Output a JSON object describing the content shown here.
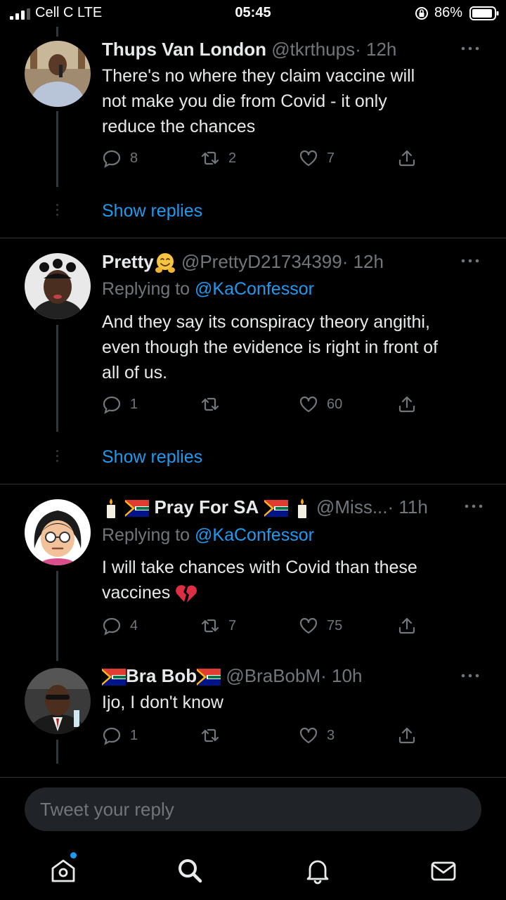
{
  "status_bar": {
    "carrier": "Cell C  LTE",
    "time": "05:45",
    "battery_percent": "86%",
    "icons": [
      "signal-icon",
      "orientation-lock-icon",
      "battery-icon"
    ]
  },
  "tweets": [
    {
      "display_name": "Thups Van London",
      "handle": "@tkrthups",
      "time": "· 12h",
      "text_lines": [
        "There's no where they claim vaccine will",
        "not make you die from Covid - it only",
        "reduce the chances"
      ],
      "replies": "8",
      "retweets": "2",
      "likes": "7",
      "show_replies": "Show replies"
    },
    {
      "display_name": "Pretty",
      "handle": "@PrettyD21734399",
      "time": "· 12h",
      "replying_prefix": "Replying to ",
      "replying_to": "@KaConfessor",
      "text_lines": [
        "And they say its conspiracy theory angithi,",
        "even though the evidence is right in front of",
        "all of us."
      ],
      "replies": "1",
      "retweets": "",
      "likes": "60",
      "show_replies": "Show replies"
    },
    {
      "display_name": "Pray For SA",
      "handle": "@Miss...",
      "time": "· 11h",
      "replying_prefix": "Replying to ",
      "replying_to": "@KaConfessor",
      "text_lines": [
        "I will take chances with Covid than these",
        "vaccines"
      ],
      "replies": "4",
      "retweets": "7",
      "likes": "75"
    },
    {
      "display_name": "Bra Bob",
      "handle": "@BraBobM",
      "time": "· 10h",
      "text_lines": [
        "Ijo, I don't know"
      ],
      "replies": "1",
      "retweets": "",
      "likes": "3"
    }
  ],
  "reply_box": {
    "placeholder": "Tweet your reply"
  },
  "tabbar": {
    "items": [
      "home-icon",
      "search-icon",
      "notifications-icon",
      "messages-icon"
    ]
  },
  "colors": {
    "background": "#000000",
    "accent": "#1d9bf0",
    "muted": "#71767b",
    "divider": "#2f3336"
  }
}
